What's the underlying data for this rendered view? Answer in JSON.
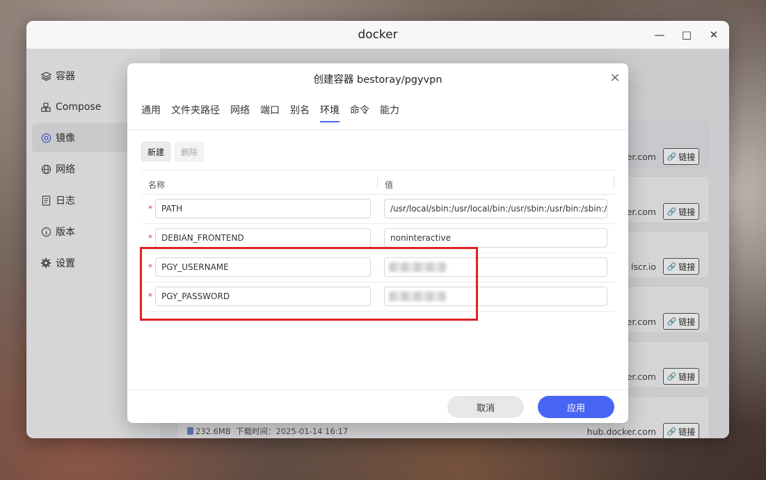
{
  "window": {
    "title": "docker",
    "minimize": "—",
    "maximize": "□",
    "close": "✕"
  },
  "sidebar": {
    "items": [
      {
        "label": "容器",
        "icon": "layers-icon"
      },
      {
        "label": "Compose",
        "icon": "cubes-icon"
      },
      {
        "label": "镜像",
        "icon": "target-icon",
        "active": true
      },
      {
        "label": "网络",
        "icon": "globe-icon"
      },
      {
        "label": "日志",
        "icon": "document-icon"
      },
      {
        "label": "版本",
        "icon": "info-icon"
      },
      {
        "label": "设置",
        "icon": "gear-icon"
      }
    ]
  },
  "background_list": {
    "sources": [
      "cker.com",
      "cker.com",
      "lscr.io",
      "cker.com",
      "cker.com",
      "hub.docker.com"
    ],
    "link_label": "链接",
    "last_card_meta": {
      "size": "232.6MB",
      "download_label": "下载时间：",
      "download_time": "2025-01-14 16:17"
    }
  },
  "modal": {
    "title": "创建容器 bestoray/pgyvpn",
    "close": "×",
    "tabs": [
      "通用",
      "文件夹路径",
      "网络",
      "端口",
      "别名",
      "环境",
      "命令",
      "能力"
    ],
    "active_tab": "环境",
    "new_button": "新建",
    "delete_button": "删除",
    "columns": {
      "name": "名称",
      "value": "值"
    },
    "rows": [
      {
        "name": "PATH",
        "value": "/usr/local/sbin:/usr/local/bin:/usr/sbin:/usr/bin:/sbin:/bin"
      },
      {
        "name": "DEBIAN_FRONTEND",
        "value": "noninteractive"
      },
      {
        "name": "PGY_USERNAME",
        "value": ""
      },
      {
        "name": "PGY_PASSWORD",
        "value": ""
      }
    ],
    "required_mark": "*",
    "cancel_button": "取消",
    "apply_button": "应用"
  },
  "colors": {
    "accent": "#4765f5",
    "highlight_box": "#e02020",
    "required": "#e03a3a"
  }
}
